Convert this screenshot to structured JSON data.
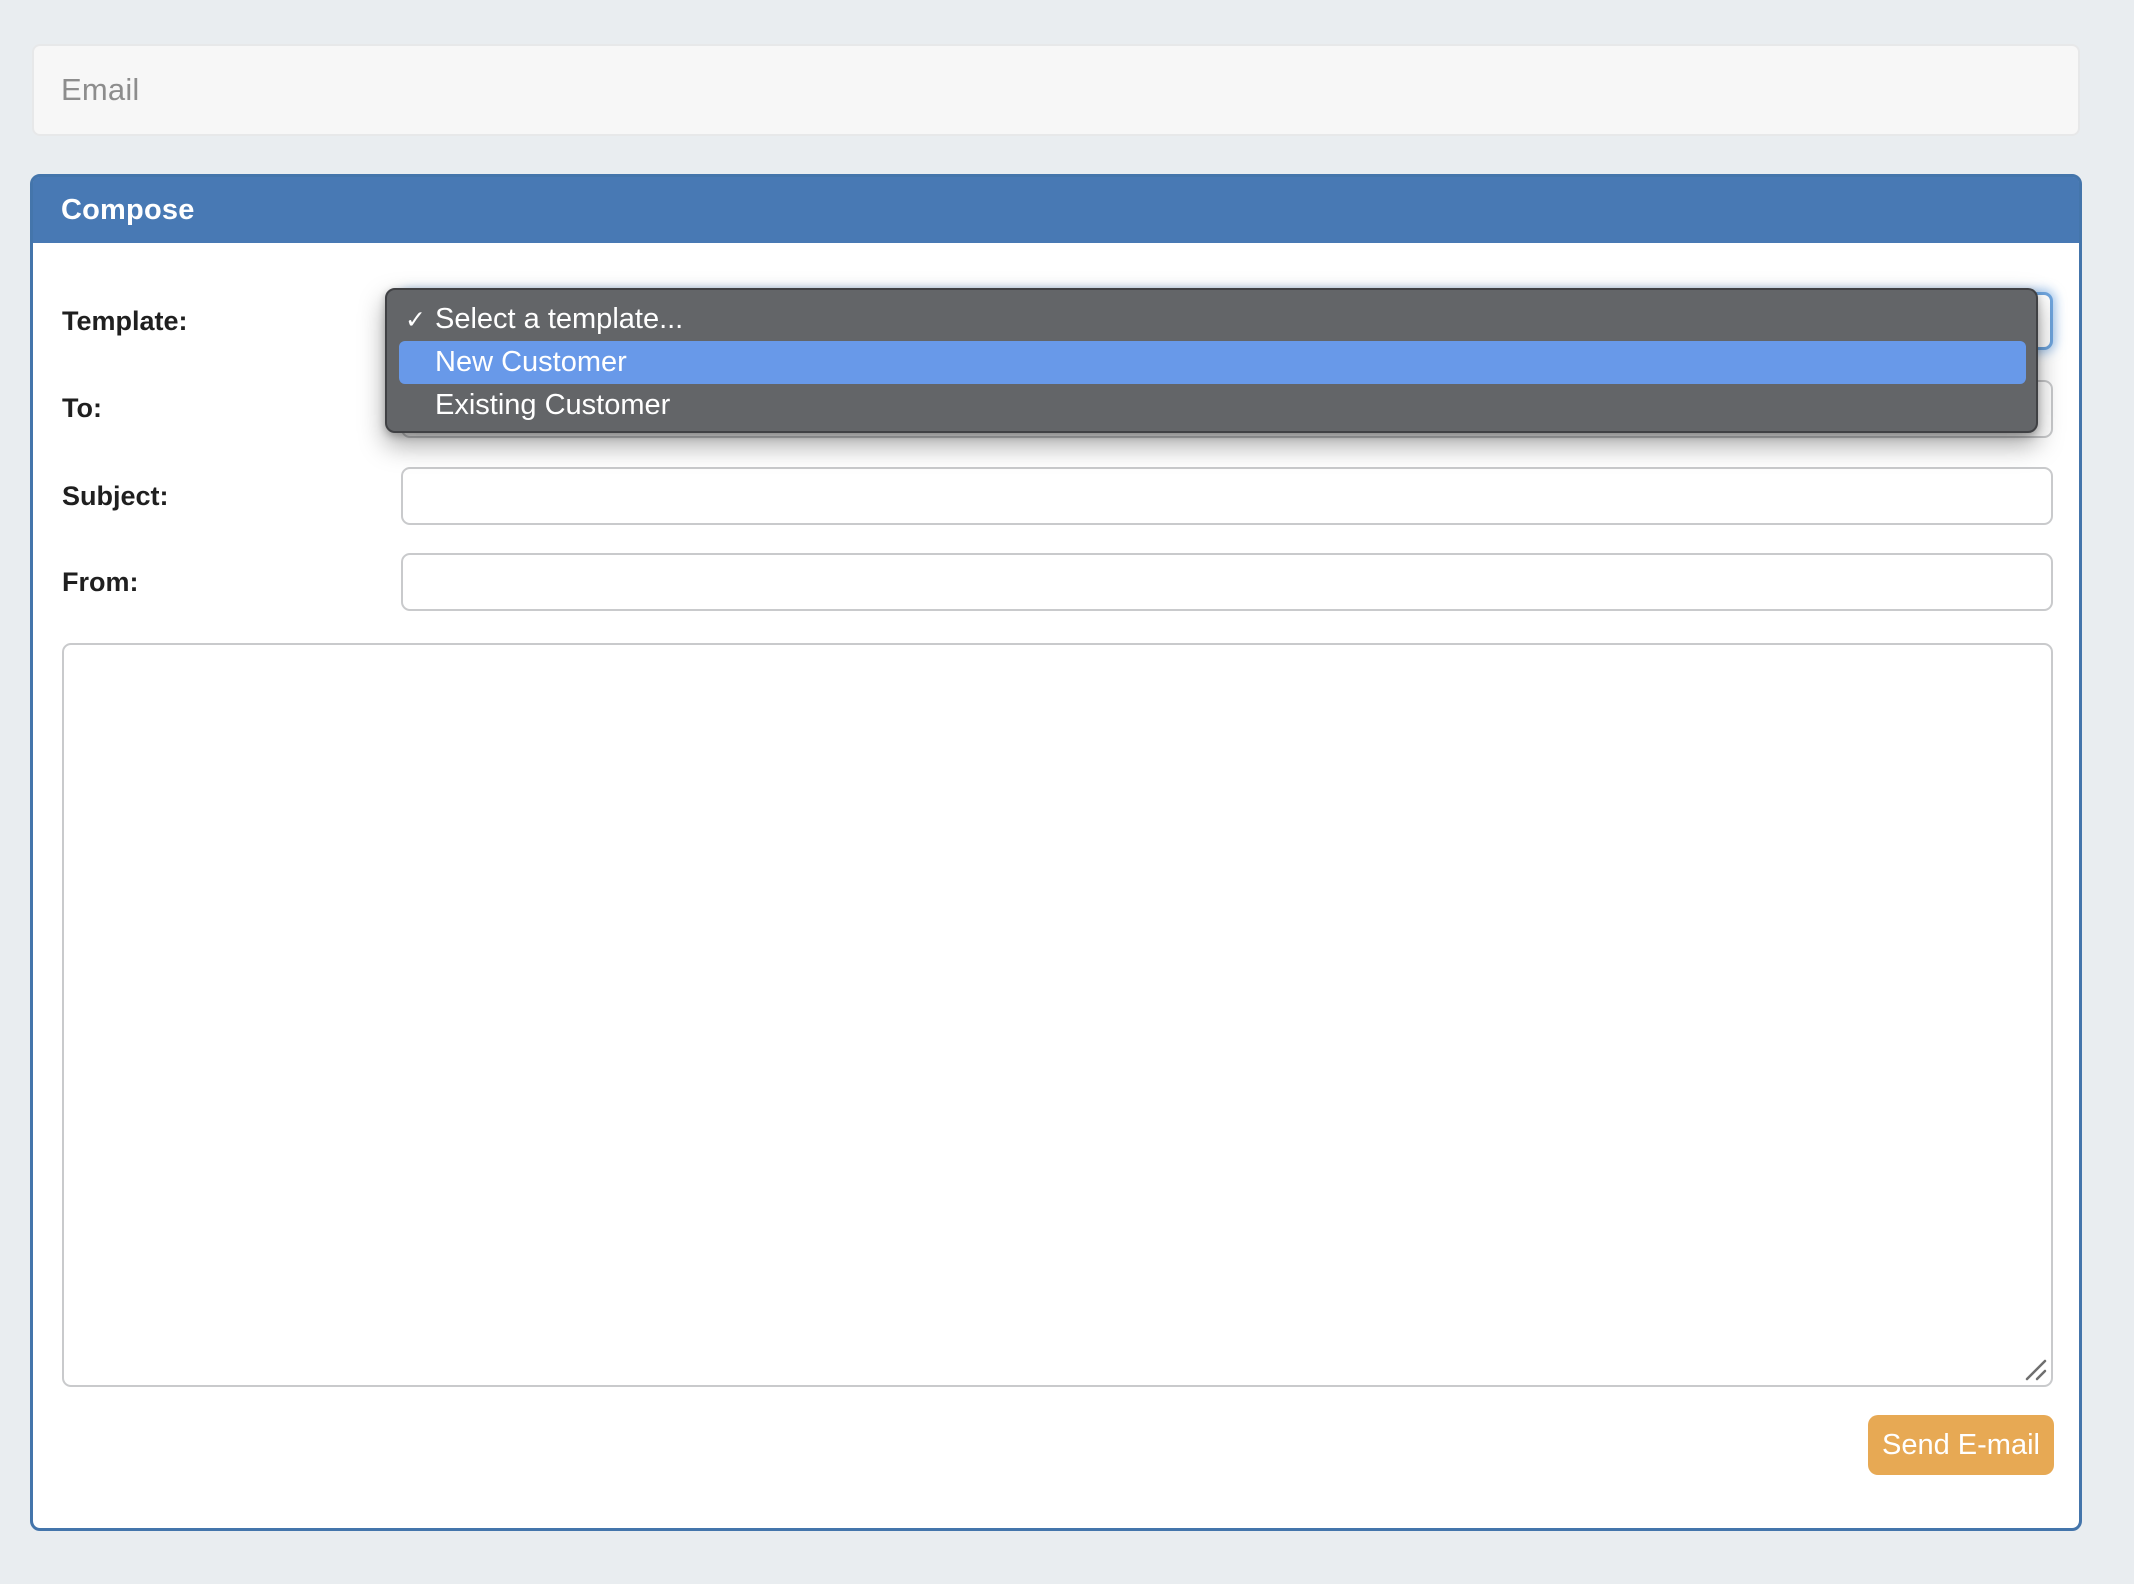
{
  "page_header": {
    "title": "Email"
  },
  "compose": {
    "title": "Compose",
    "labels": {
      "template": "Template:",
      "to": "To:",
      "subject": "Subject:",
      "from": "From:"
    },
    "values": {
      "to": "",
      "subject": "",
      "from": "",
      "body": ""
    },
    "send_button_label": "Send E-mail"
  },
  "template_dropdown": {
    "open": true,
    "checkmark_glyph": "✓",
    "selected_option": "Select a template...",
    "highlighted_option": "New Customer",
    "items": [
      {
        "label": "Select a template...",
        "checked": true,
        "highlighted": false
      },
      {
        "label": "New Customer",
        "checked": false,
        "highlighted": true
      },
      {
        "label": "Existing Customer",
        "checked": false,
        "highlighted": false
      }
    ]
  },
  "colors": {
    "page_background": "#e9edf0",
    "section_header_background": "#f7f7f7",
    "section_header_text": "#8d8d8d",
    "compose_header_blue": "#4879b4",
    "compose_border_blue": "#4475ab",
    "input_border": "#c9cacc",
    "focus_ring_blue": "#6ea4dd",
    "dropdown_background": "#636568",
    "dropdown_highlight_blue": "#6899e9",
    "dropdown_text": "#ffffff",
    "send_button_orange": "#e7a954",
    "send_button_text": "#ffffff"
  }
}
